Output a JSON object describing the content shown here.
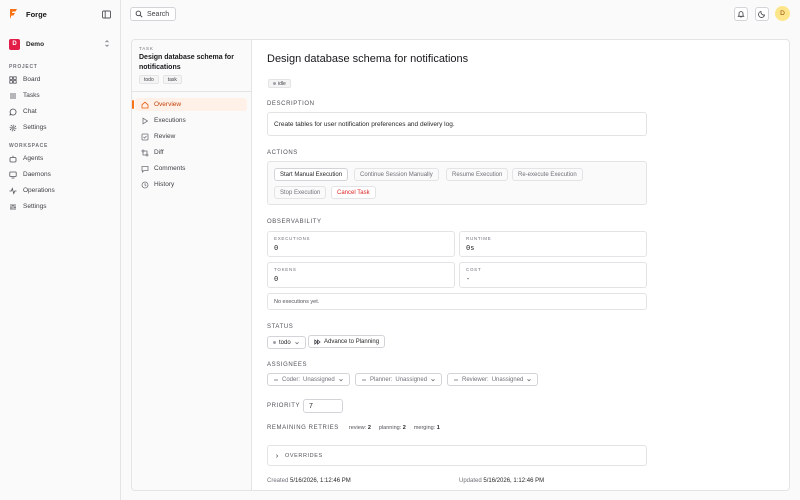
{
  "app": {
    "name": "Forge"
  },
  "workspace": {
    "initial": "D",
    "name": "Demo"
  },
  "sidebar": {
    "project_title": "PROJECT",
    "project_items": [
      {
        "label": "Board",
        "icon": "board-icon"
      },
      {
        "label": "Tasks",
        "icon": "list-icon"
      },
      {
        "label": "Chat",
        "icon": "chat-icon"
      },
      {
        "label": "Settings",
        "icon": "gear-icon"
      }
    ],
    "workspace_title": "WORKSPACE",
    "workspace_items": [
      {
        "label": "Agents",
        "icon": "agents-icon"
      },
      {
        "label": "Daemons",
        "icon": "monitor-icon"
      },
      {
        "label": "Operations",
        "icon": "activity-icon"
      },
      {
        "label": "Settings",
        "icon": "sliders-icon"
      }
    ]
  },
  "topbar": {
    "search_label": "Search",
    "avatar_initial": "D"
  },
  "task": {
    "label": "TASK",
    "title": "Design database schema for notifications",
    "tags": [
      "todo",
      "task"
    ],
    "nav": [
      {
        "label": "Overview",
        "icon": "home-icon",
        "active": true
      },
      {
        "label": "Executions",
        "icon": "play-icon"
      },
      {
        "label": "Review",
        "icon": "review-icon"
      },
      {
        "label": "Diff",
        "icon": "diff-icon"
      },
      {
        "label": "Comments",
        "icon": "comment-icon"
      },
      {
        "label": "History",
        "icon": "history-icon"
      }
    ]
  },
  "detail": {
    "title": "Design database schema for notifications",
    "state": "idle",
    "description_title": "DESCRIPTION",
    "description": "Create tables for user notification preferences and delivery log.",
    "actions_title": "ACTIONS",
    "actions": {
      "start": "Start Manual Execution",
      "continue": "Continue Session Manually",
      "resume": "Resume Execution",
      "reexecute": "Re-execute Execution",
      "stop": "Stop Execution",
      "cancel": "Cancel Task"
    },
    "observability_title": "OBSERVABILITY",
    "observability": {
      "executions_label": "EXECUTIONS",
      "executions": "0",
      "runtime_label": "RUNTIME",
      "runtime": "0s",
      "tokens_label": "TOKENS",
      "tokens": "0",
      "cost_label": "COST",
      "cost": "-"
    },
    "no_executions": "No executions yet.",
    "status_title": "STATUS",
    "status_value": "todo",
    "advance_label": "Advance to Planning",
    "assignees_title": "ASSIGNEES",
    "assignees": [
      {
        "role": "Coder:",
        "value": "Unassigned"
      },
      {
        "role": "Planner:",
        "value": "Unassigned"
      },
      {
        "role": "Reviewer:",
        "value": "Unassigned"
      }
    ],
    "priority_title": "PRIORITY",
    "priority": "7",
    "retries_title": "REMAINING RETRIES",
    "retries": {
      "review_label": "review:",
      "review": "2",
      "planning_label": "planning:",
      "planning": "2",
      "merging_label": "merging:",
      "merging": "1"
    },
    "overrides_title": "OVERRIDES",
    "created_label": "Created",
    "created": "5/16/2026, 1:12:46 PM",
    "updated_label": "Updated",
    "updated": "5/16/2026, 1:12:46 PM"
  },
  "colors": {
    "accent": "#f97316",
    "danger": "#dc2626",
    "logo": "#f97316"
  }
}
